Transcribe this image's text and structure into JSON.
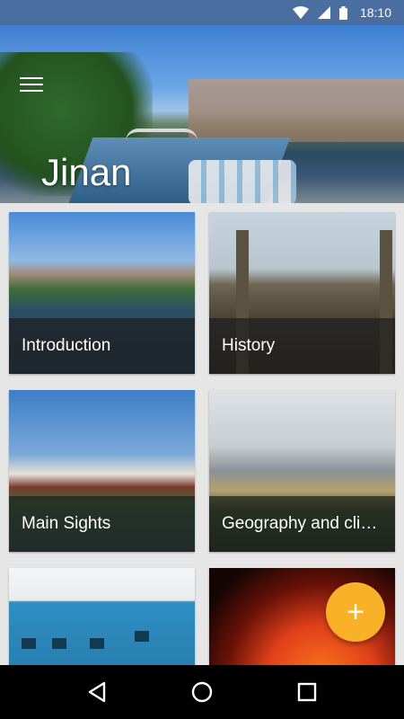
{
  "status_bar": {
    "time": "18:10",
    "icons": [
      "wifi-icon",
      "signal-icon",
      "battery-icon"
    ]
  },
  "header": {
    "title": "Jinan",
    "menu_icon": "hamburger-menu-icon"
  },
  "cards": [
    {
      "label": "Introduction"
    },
    {
      "label": "History"
    },
    {
      "label": "Main Sights"
    },
    {
      "label": "Geography and clim…"
    },
    {
      "label": ""
    },
    {
      "label": ""
    }
  ],
  "fab": {
    "icon": "plus-icon",
    "symbol": "+",
    "color": "#f9b227"
  },
  "nav": {
    "back": "back-icon",
    "home": "home-icon",
    "recents": "recents-icon"
  },
  "colors": {
    "status_bar": "#4a6ea0",
    "accent": "#f9b227",
    "background": "#e6e6e6"
  }
}
